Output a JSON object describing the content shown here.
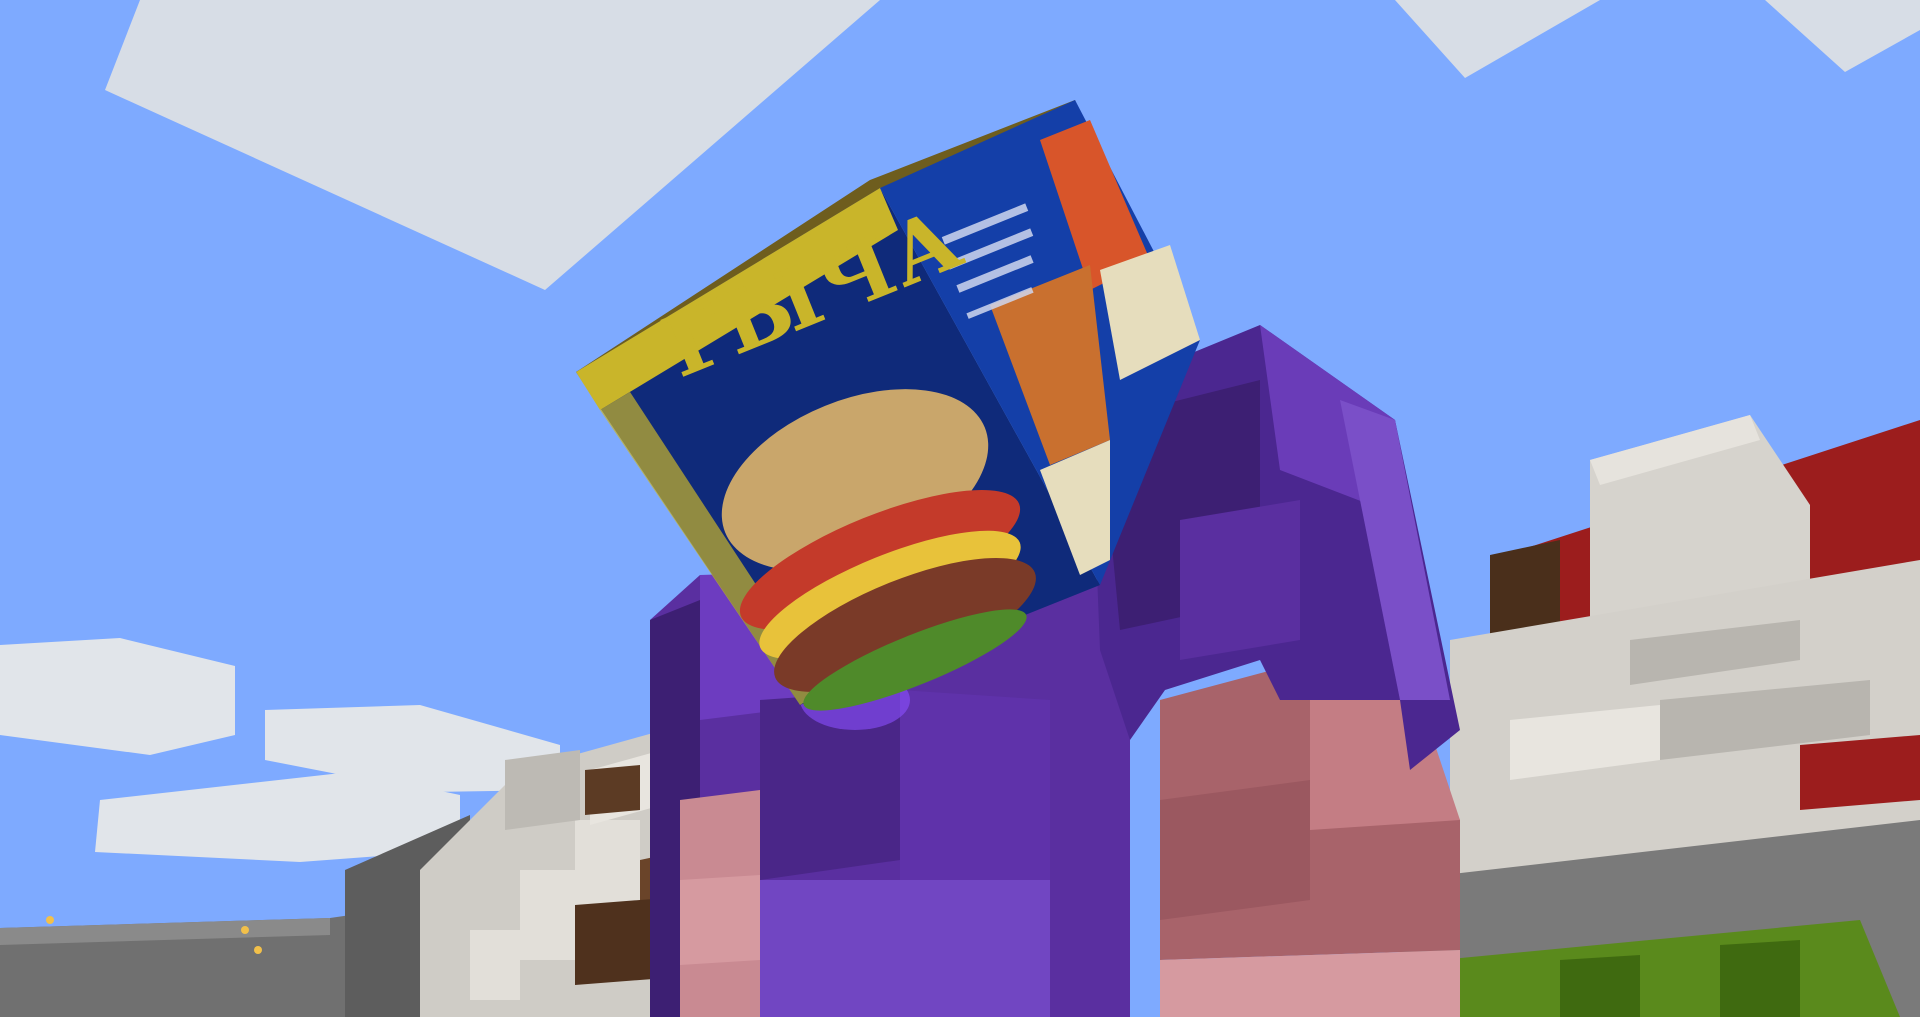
{
  "scene": {
    "sky_color": "#7eaaff",
    "cloud_color": "#d7dde6",
    "cube_front_title": "ГЫЧА",
    "colors": {
      "purple_dark": "#3d1f73",
      "purple_mid": "#5a2fa0",
      "purple_light": "#7a4fc8",
      "skin": "#b57178",
      "skin_light": "#d69aa0",
      "wool_white": "#d6d3cd",
      "wool_red": "#9c1d1d",
      "stone": "#6e6e6e",
      "cube_blue": "#0f2a7a",
      "cube_gold": "#c9b52a",
      "wood": "#5c3b24",
      "leaves": "#5a8a1c"
    }
  }
}
